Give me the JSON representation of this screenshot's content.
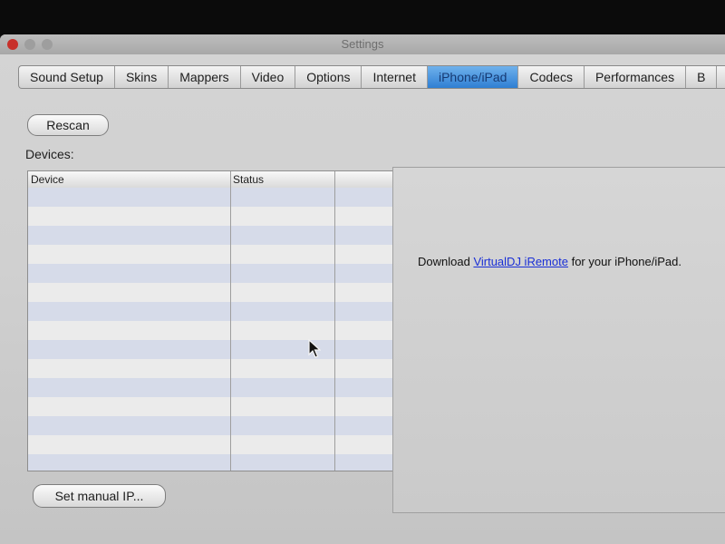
{
  "window": {
    "title": "Settings"
  },
  "tabs": [
    {
      "label": "Sound Setup",
      "active": false
    },
    {
      "label": "Skins",
      "active": false
    },
    {
      "label": "Mappers",
      "active": false
    },
    {
      "label": "Video",
      "active": false
    },
    {
      "label": "Options",
      "active": false
    },
    {
      "label": "Internet",
      "active": false
    },
    {
      "label": "iPhone/iPad",
      "active": true
    },
    {
      "label": "Codecs",
      "active": false
    },
    {
      "label": "Performances",
      "active": false
    },
    {
      "label": "B",
      "active": false
    }
  ],
  "toolbar": {
    "rescan_label": "Rescan"
  },
  "devices": {
    "label": "Devices:",
    "columns": [
      "Device",
      "Status",
      ""
    ],
    "rows": []
  },
  "info": {
    "prefix": "Download ",
    "link_text": "VirtualDJ iRemote",
    "suffix": " for your iPhone/iPad."
  },
  "footer": {
    "manual_ip_label": "Set manual IP..."
  },
  "colors": {
    "active_tab": "#3d8ee0",
    "link": "#1a2fd6",
    "row_stripe": "#d6dbe9"
  },
  "icons": {
    "pointer": "arrow-cursor-icon"
  }
}
